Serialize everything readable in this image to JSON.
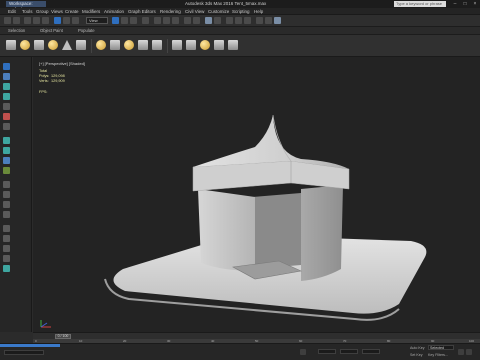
{
  "titlebar": {
    "workspace": "Workspace: Default",
    "title": "Autodesk 3ds Max 2016    Tent_5max.max",
    "search_placeholder": "Type a keyword or phrase"
  },
  "menu": {
    "items": [
      "Edit",
      "Tools",
      "Group",
      "Views",
      "Create",
      "Modifiers",
      "Animation",
      "Graph Editors",
      "Rendering",
      "Civil View",
      "Customize",
      "Scripting",
      "Help"
    ]
  },
  "toolbar": {
    "view_dropdown": "View"
  },
  "ribbon": {
    "tabs": [
      "Selection",
      "Object Paint",
      "Populate"
    ]
  },
  "viewport": {
    "label": "[+] [Perspective] [Shaded]",
    "stats": [
      {
        "label": "Total",
        "value": ""
      },
      {
        "label": "Polys:",
        "value": "129,098"
      },
      {
        "label": "Verts:",
        "value": "129,909"
      },
      {
        "label": "FPS:",
        "value": ""
      }
    ]
  },
  "timeline": {
    "frame": "0 / 100",
    "ticks": [
      "0",
      "10",
      "20",
      "30",
      "40",
      "50",
      "60",
      "70",
      "80",
      "90",
      "100"
    ]
  },
  "status": {
    "auto_key": "Auto Key",
    "selected": "Selected",
    "set_key": "Set Key",
    "key_filters": "Key Filters..."
  },
  "colors": {
    "accent": "#2f6fbf",
    "viewport_bg": "#232323",
    "stat_text": "#e6e6a0"
  }
}
